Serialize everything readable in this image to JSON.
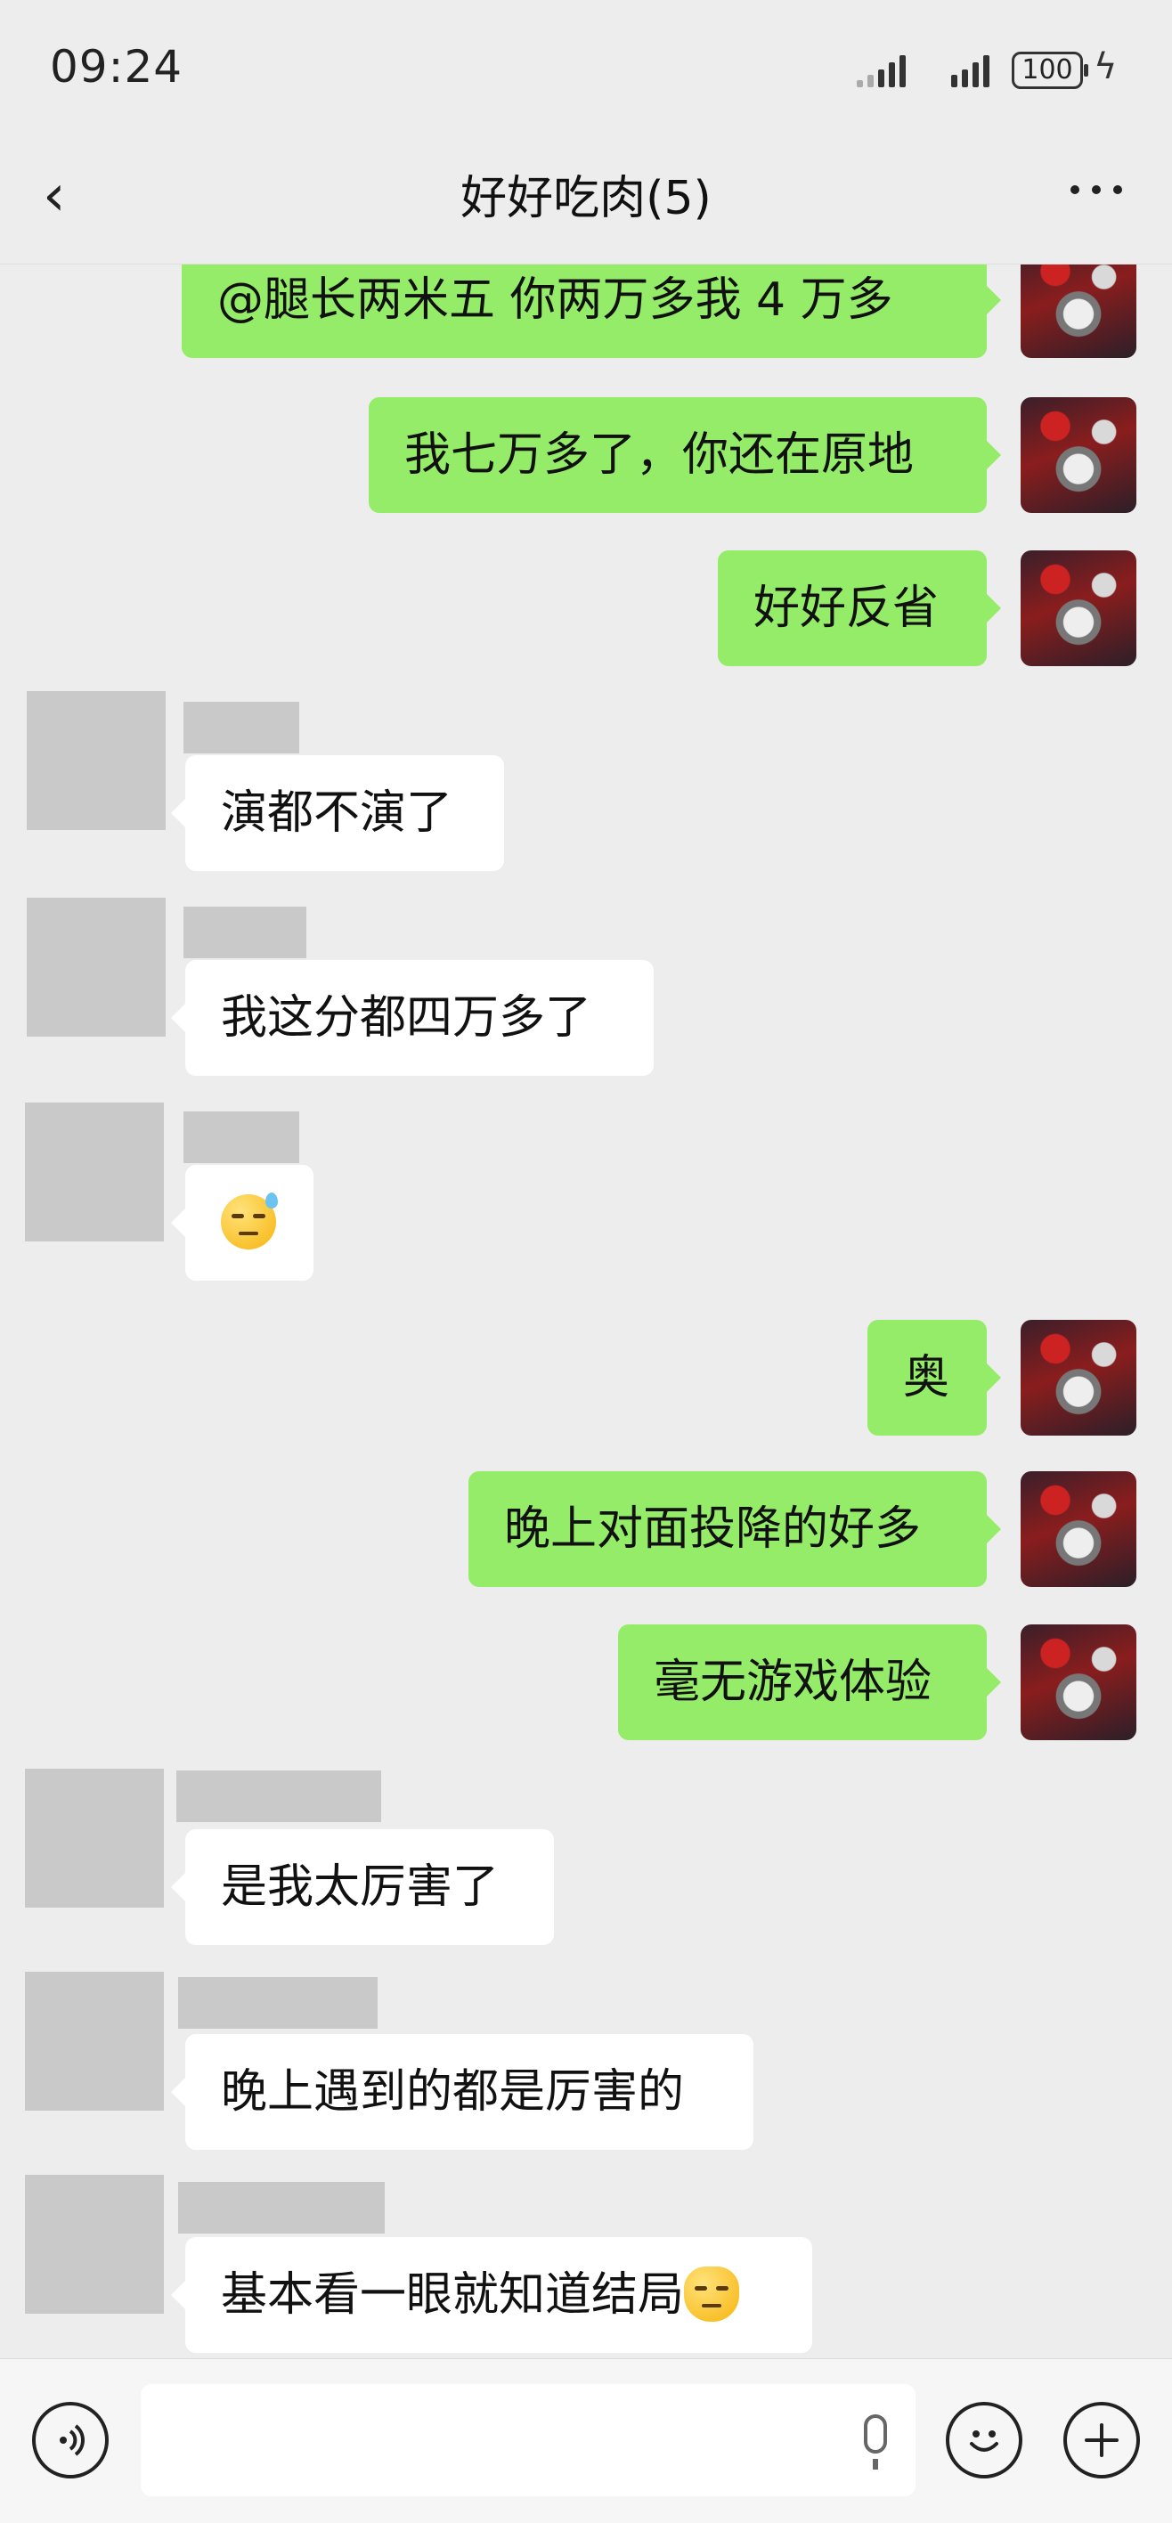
{
  "status_bar": {
    "time": "09:24",
    "battery": "100"
  },
  "header": {
    "title": "好好吃肉(5)"
  },
  "messages": [
    {
      "side": "me",
      "text": "@腿长两米五  你两万多我 4 万多"
    },
    {
      "side": "me",
      "text": "我七万多了，你还在原地"
    },
    {
      "side": "me",
      "text": "好好反省"
    },
    {
      "side": "other",
      "text": "演都不演了"
    },
    {
      "side": "other",
      "text": "我这分都四万多了"
    },
    {
      "side": "other",
      "text": "",
      "emoji": "sweat-smile-emoji"
    },
    {
      "side": "me",
      "text": "奥"
    },
    {
      "side": "me",
      "text": "晚上对面投降的好多"
    },
    {
      "side": "me",
      "text": "毫无游戏体验"
    },
    {
      "side": "other",
      "text": "是我太厉害了"
    },
    {
      "side": "other",
      "text": "晚上遇到的都是厉害的"
    },
    {
      "side": "other",
      "text": "基本看一眼就知道结局",
      "emoji": "doge-cat-emoji"
    }
  ],
  "icons": {
    "back": "chevron-left-icon",
    "more": "more-dots-icon",
    "voice": "voice-icon",
    "mic": "microphone-icon",
    "emoji": "emoji-icon",
    "plus": "plus-icon"
  },
  "colors": {
    "my_bubble": "#95ec69",
    "other_bubble": "#ffffff",
    "background": "#ededed"
  }
}
